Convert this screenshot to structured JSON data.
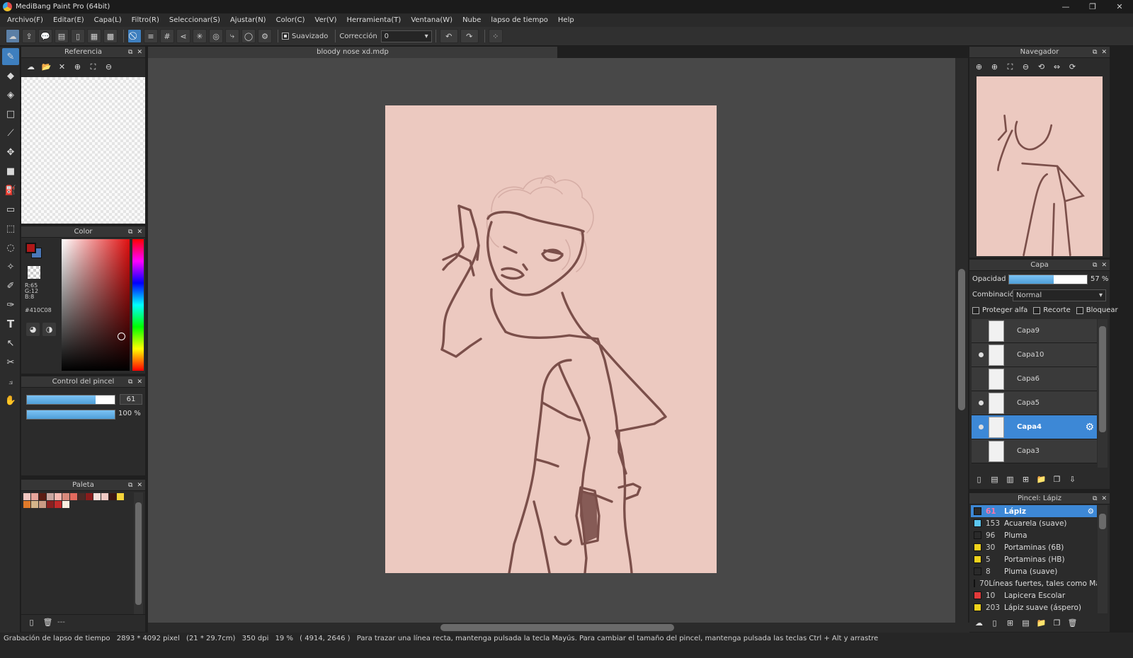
{
  "window": {
    "title": "MediBang Paint Pro (64bit)",
    "controls": [
      "—",
      "❐",
      "✕"
    ]
  },
  "menu": [
    "Archivo(F)",
    "Editar(E)",
    "Capa(L)",
    "Filtro(R)",
    "Seleccionar(S)",
    "Ajustar(N)",
    "Color(C)",
    "Ver(V)",
    "Herramienta(T)",
    "Ventana(W)",
    "Nube",
    "lapso de tiempo",
    "Help"
  ],
  "toolbar": {
    "smoothing_label": "Suavizado",
    "correction_label": "Corrección",
    "correction_value": "0"
  },
  "document": {
    "tab": "bloody nose xd.mdp",
    "bg_color": "#ecc9c0",
    "line_color": "#7b4f4a"
  },
  "reference": {
    "title": "Referencia"
  },
  "color_panel": {
    "title": "Color",
    "r": "R:65",
    "g": "G:12",
    "b": "B:8",
    "hex": "#410C08",
    "fg": "#b01818",
    "bg": "#4b78b8"
  },
  "brush_control": {
    "title": "Control del pincel",
    "size": "61",
    "opacity": "100 %",
    "size_fraction": 0.78,
    "opacity_fraction": 1.0
  },
  "palette": {
    "title": "Paleta",
    "colors": [
      "#f2c6c0",
      "#e8a59b",
      "#5a1d14",
      "#c9a6a0",
      "#f7b8b0",
      "#d98a7c",
      "#e26a5e",
      "#4a2a26",
      "#8a1c1c",
      "#f5ddd8",
      "#f0c9c3",
      "#3b1512",
      "#f5d43a",
      "#e07a2a",
      "#d4b48a",
      "#c89a84",
      "#8a2020",
      "#c42a2a",
      "#fbeee0"
    ],
    "footer": "---"
  },
  "navigator": {
    "title": "Navegador"
  },
  "layers": {
    "title": "Capa",
    "opacity_label": "Opacidad",
    "opacity_value": "57 %",
    "opacity_fraction": 0.57,
    "blend_label": "Combinación",
    "blend_value": "Normal",
    "protect_alpha": "Proteger alfa",
    "clip": "Recorte",
    "lock": "Bloquear",
    "items": [
      {
        "name": "Capa9",
        "visible": false
      },
      {
        "name": "Capa10",
        "visible": true
      },
      {
        "name": "Capa6",
        "visible": false
      },
      {
        "name": "Capa5",
        "visible": true
      },
      {
        "name": "Capa4",
        "visible": true,
        "selected": true
      },
      {
        "name": "Capa3",
        "visible": false
      }
    ]
  },
  "brushes": {
    "title": "Pincel: Lápiz",
    "items": [
      {
        "size": "61",
        "name": "Lápiz",
        "color": "#2a2a2a",
        "selected": true
      },
      {
        "size": "153",
        "name": "Acuarela (suave)",
        "color": "#5cc6f0"
      },
      {
        "size": "96",
        "name": "Pluma",
        "color": "#2a2a2a"
      },
      {
        "size": "30",
        "name": "Portaminas (6B)",
        "color": "#f0d21c"
      },
      {
        "size": "5",
        "name": "Portaminas (HB)",
        "color": "#f0d21c"
      },
      {
        "size": "8",
        "name": "Pluma (suave)",
        "color": "#2a2a2a"
      },
      {
        "size": "70",
        "name": "Líneas fuertes, tales como Manga",
        "color": "#e23a3a"
      },
      {
        "size": "10",
        "name": "Lapicera Escolar",
        "color": "#e23a3a"
      },
      {
        "size": "203",
        "name": "Lápiz suave (áspero)",
        "color": "#f0d21c"
      }
    ]
  },
  "status": {
    "items": [
      "Grabación de lapso de tiempo",
      "2893 * 4092 pixel",
      "(21 * 29.7cm)",
      "350 dpi",
      "19 %",
      "( 4914, 2646 )",
      "Para trazar una línea recta, mantenga pulsada la tecla Mayús. Para cambiar el tamaño del pincel, mantenga pulsada las teclas Ctrl + Alt y arrastre"
    ]
  }
}
